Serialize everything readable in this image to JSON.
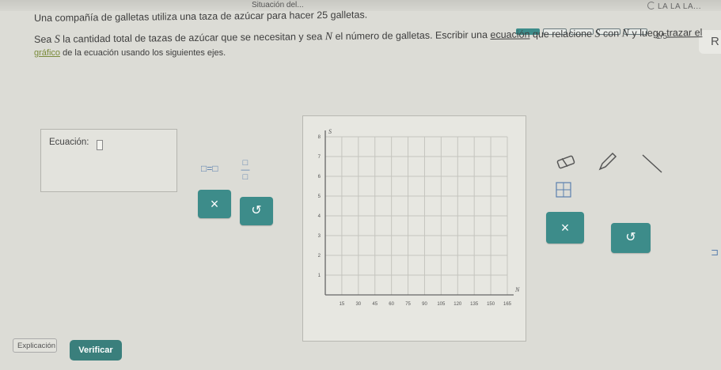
{
  "topbar": {
    "title": "Situación del...",
    "user": "LA LA LA..."
  },
  "progress": {
    "count": "1/5",
    "segments_total": 5,
    "segments_filled": 1
  },
  "side_button": {
    "label": "R"
  },
  "prompt": {
    "line1": "Una compañía de galletas utiliza una taza de azúcar para hacer 25 galletas.",
    "line2_pre": "Sea ",
    "var_s": "S",
    "line2_mid": " la cantidad total de tazas de azúcar que se necesitan y sea ",
    "var_n": "N",
    "line2_post": " el número de galletas. Escribir una ",
    "link_ecuacion": "ecuación",
    "line2_end1": " que relacione ",
    "line2_end2": " con ",
    "line2_end3": " y luego ",
    "link_trazar": "trazar el",
    "line3_link": "gráfico",
    "line3_rest": " de la ecuación usando los siguientes ejes."
  },
  "equation_panel": {
    "label": "Ecuación:",
    "tool_equal": "□=□",
    "tool_fraction": "□/□",
    "clear_symbol": "×",
    "undo_symbol": "↺"
  },
  "graph": {
    "y_ticks": [
      "8",
      "7",
      "6",
      "5",
      "4",
      "3",
      "2",
      "1"
    ],
    "x_ticks": [
      "15",
      "30",
      "45",
      "60",
      "75",
      "90",
      "105",
      "120",
      "135",
      "150",
      "165"
    ],
    "x_axis_label": "N",
    "y_axis_label": "S"
  },
  "graph_tools": {
    "clear_symbol": "×",
    "undo_symbol": "↺"
  },
  "buttons": {
    "explain": "Explicación",
    "verify": "Verificar"
  },
  "colors": {
    "accent": "#3d8c8a",
    "link": "#7a8b3a",
    "background": "#dcdcd6"
  }
}
